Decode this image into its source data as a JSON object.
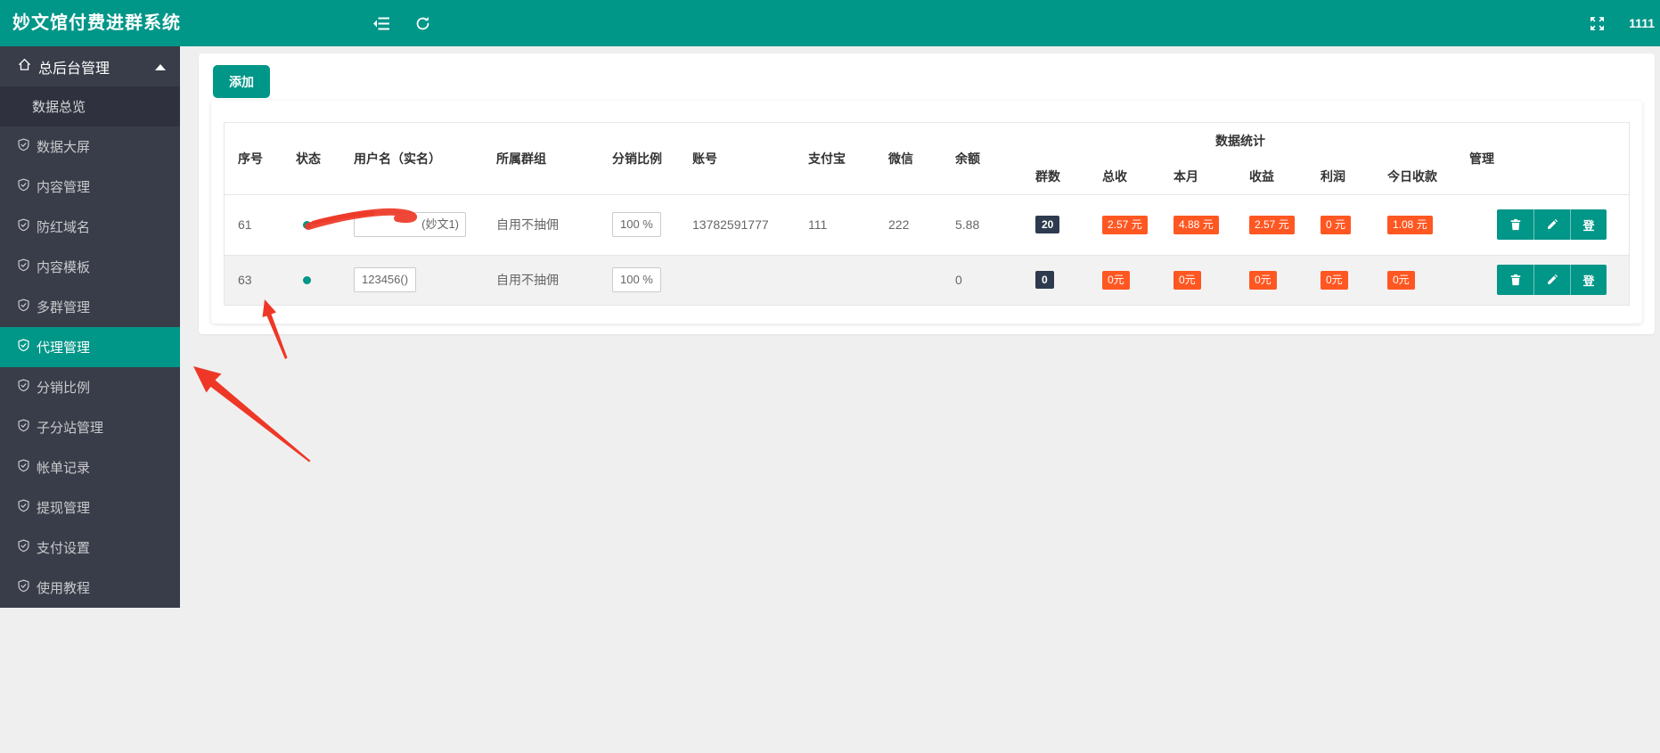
{
  "header": {
    "title": "妙文馆付费进群系统",
    "user": "1111",
    "icons": {
      "collapse": "collapse-menu-icon",
      "refresh": "refresh-icon",
      "fullscreen": "fullscreen-icon"
    }
  },
  "colors": {
    "accent_teal": "#009688",
    "badge_orange": "#FF5722",
    "badge_dark": "#2e3b4e",
    "sidebar_bg": "#393D49",
    "annotation_red": "#ee3726"
  },
  "sidebar": {
    "parent": "总后台管理",
    "submenu_item": "数据总览",
    "items": [
      "数据大屏",
      "内容管理",
      "防红域名",
      "内容模板",
      "多群管理",
      "代理管理",
      "分销比例",
      "子分站管理",
      "帐单记录",
      "提现管理",
      "支付设置",
      "使用教程"
    ],
    "active_item": "代理管理"
  },
  "toolbar": {
    "add": "添加"
  },
  "table": {
    "columns": [
      "序号",
      "状态",
      "用户名（实名）",
      "所属群组",
      "分销比例",
      "账号",
      "支付宝",
      "微信",
      "余额"
    ],
    "stats_group": "数据统计",
    "stat_columns": [
      "群数",
      "总收",
      "本月",
      "收益",
      "利润",
      "今日收款"
    ],
    "manage": "管理",
    "actions": {
      "delete": "trash-icon",
      "edit": "pencil-icon",
      "login": "登"
    },
    "rows": [
      {
        "seq": "61",
        "status": "online",
        "username": "(妙文1)",
        "username_redacted": true,
        "group": "自用不抽佣",
        "ratio": "100 %",
        "account": "13782591777",
        "alipay": "111",
        "wechat": "222",
        "balance": "5.88",
        "group_count": "20",
        "total": "2.57 元",
        "month": "4.88 元",
        "income": "2.57 元",
        "profit": "0 元",
        "today": "1.08 元"
      },
      {
        "seq": "63",
        "status": "online",
        "username": "123456()",
        "username_redacted": false,
        "group": "自用不抽佣",
        "ratio": "100 %",
        "account": "",
        "alipay": "",
        "wechat": "",
        "balance": "0",
        "group_count": "0",
        "total": "0元",
        "month": "0元",
        "income": "0元",
        "profit": "0元",
        "today": "0元"
      }
    ]
  }
}
